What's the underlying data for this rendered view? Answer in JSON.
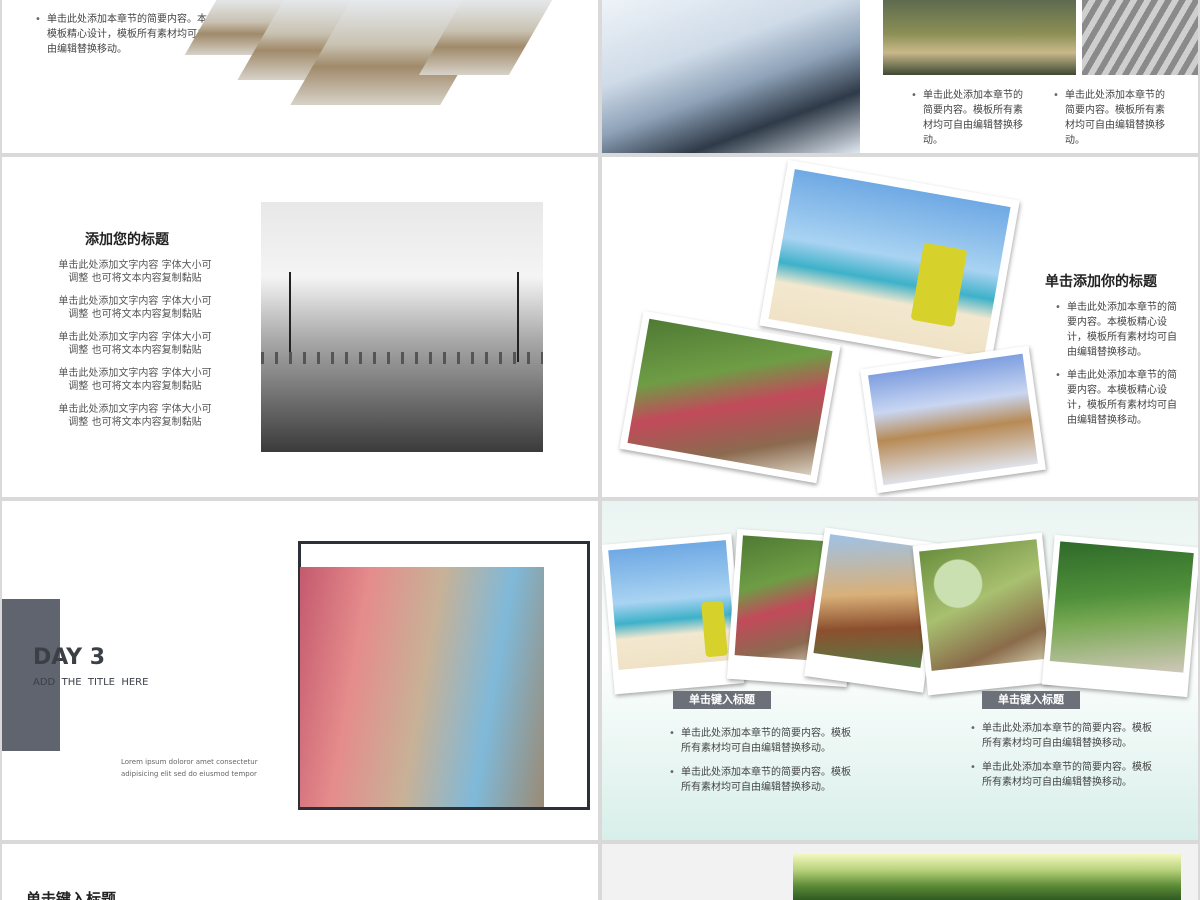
{
  "slides": {
    "s1": {
      "bullets": [
        "单击此处添加本章节的简要内容。本模板精心设计，模板所有素材均可自由编辑替换移动。"
      ]
    },
    "s2": {
      "photo_credit": "",
      "bullets": [
        "单击此处添加本章节的简要内容。模板所有素材均可自由编辑替换移动。",
        "单击此处添加本章节的简要内容。模板所有素材均可自由编辑替换移动。"
      ]
    },
    "s3": {
      "title": "添加您的标题",
      "lines": [
        "单击此处添加文字内容 字体大小可调整 也可将文本内容复制黏贴",
        "单击此处添加文字内容 字体大小可调整 也可将文本内容复制黏贴",
        "单击此处添加文字内容 字体大小可调整 也可将文本内容复制黏贴",
        "单击此处添加文字内容 字体大小可调整 也可将文本内容复制黏贴",
        "单击此处添加文字内容 字体大小可调整 也可将文本内容复制黏贴"
      ]
    },
    "s4": {
      "title": "单击添加你的标题",
      "bullets": [
        "单击此处添加本章节的简要内容。本模板精心设计，模板所有素材均可自由编辑替换移动。",
        "单击此处添加本章节的简要内容。本模板精心设计，模板所有素材均可自由编辑替换移动。"
      ]
    },
    "s5": {
      "day": "DAY 3",
      "subtitle": "ADD  THE  TITLE  HERE",
      "lorem": "Lorem ipsum doloror amet consectetur adipisicing elit sed do eiusmod tempor"
    },
    "s6": {
      "left_tag": "单击键入标题",
      "right_tag": "单击键入标题",
      "left_bullets": [
        "单击此处添加本章节的简要内容。模板所有素材均可自由编辑替换移动。",
        "单击此处添加本章节的简要内容。模板所有素材均可自由编辑替换移动。"
      ],
      "right_bullets": [
        "单击此处添加本章节的简要内容。模板所有素材均可自由编辑替换移动。",
        "单击此处添加本章节的简要内容。模板所有素材均可自由编辑替换移动。"
      ]
    },
    "s7": {
      "title": "单击键入标题"
    }
  }
}
